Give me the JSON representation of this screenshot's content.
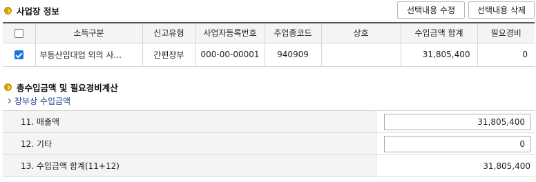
{
  "business": {
    "title": "사업장 정보",
    "buttons": {
      "edit": "선택내용 수정",
      "delete": "선택내용 삭제"
    },
    "columns": [
      "소득구분",
      "신고유형",
      "사업자등록번호",
      "주업종코드",
      "상호",
      "수입금액 합계",
      "필요경비"
    ],
    "rows": [
      {
        "checked": true,
        "income_type": "부동산임대업 외의 사...",
        "report_type": "간편장부",
        "reg_no": "000-00-00001",
        "industry_code": "940909",
        "trade_name": "",
        "revenue_total": "31,805,400",
        "expenses": "0"
      }
    ]
  },
  "calc": {
    "title": "총수입금액 및 필요경비계산",
    "subtitle": "장부상 수입금액",
    "rows": [
      {
        "label": "11. 매출액",
        "value": "31,805,400"
      },
      {
        "label": "12. 기타",
        "value": "0"
      },
      {
        "label": "13. 수입금액 합계(11+12)",
        "value": "31,805,400"
      }
    ]
  },
  "colors": {
    "accent_bullet": "#e0a000",
    "subtitle": "#1a3c8c",
    "checkbox": "#1a73e8"
  }
}
